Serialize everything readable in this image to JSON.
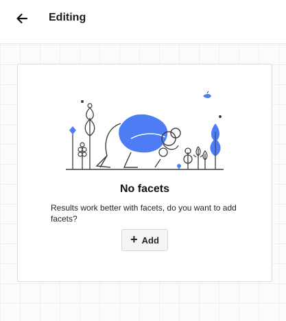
{
  "header": {
    "title": "Editing",
    "back_icon": "arrow-left-icon"
  },
  "empty_state": {
    "title": "No facets",
    "description": "Results work better with facets, do you want to add facets?",
    "illustration": "person-with-magnifier-and-plants-illustration",
    "add_button": {
      "icon": "plus-icon",
      "label": "Add"
    }
  },
  "colors": {
    "accent": "#4d7cf4",
    "line": "#3a3a3a",
    "grid": "#efefef"
  }
}
